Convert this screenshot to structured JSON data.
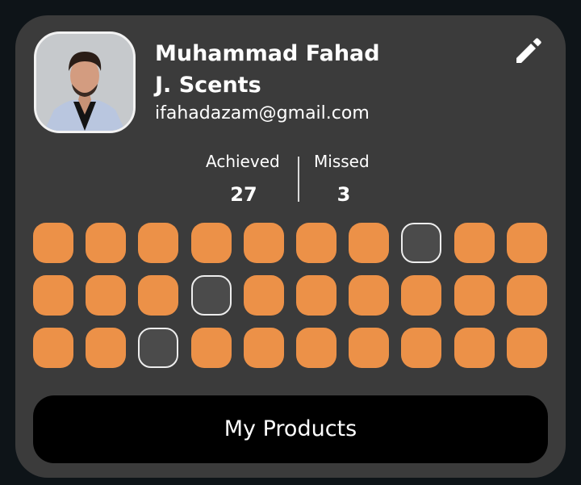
{
  "profile": {
    "name_line1": "Muhammad Fahad",
    "name_line2": "J. Scents",
    "email": "ifahadazam@gmail.com",
    "edit_icon": "pencil-icon"
  },
  "stats": {
    "achieved_label": "Achieved",
    "achieved_value": "27",
    "missed_label": "Missed",
    "missed_value": "3"
  },
  "tracker": {
    "columns": 10,
    "rows": 3,
    "days": [
      "achieved",
      "achieved",
      "achieved",
      "achieved",
      "achieved",
      "achieved",
      "achieved",
      "missed",
      "achieved",
      "achieved",
      "achieved",
      "achieved",
      "achieved",
      "missed",
      "achieved",
      "achieved",
      "achieved",
      "achieved",
      "achieved",
      "achieved",
      "achieved",
      "achieved",
      "missed",
      "achieved",
      "achieved",
      "achieved",
      "achieved",
      "achieved",
      "achieved",
      "achieved"
    ]
  },
  "actions": {
    "products_label": "My Products"
  },
  "colors": {
    "card_background": "#3b3b3b",
    "page_background": "#0e1418",
    "achieved": "#ec9148",
    "missed": "#4b4b4b",
    "button_background": "#000000",
    "text": "#ffffff"
  }
}
